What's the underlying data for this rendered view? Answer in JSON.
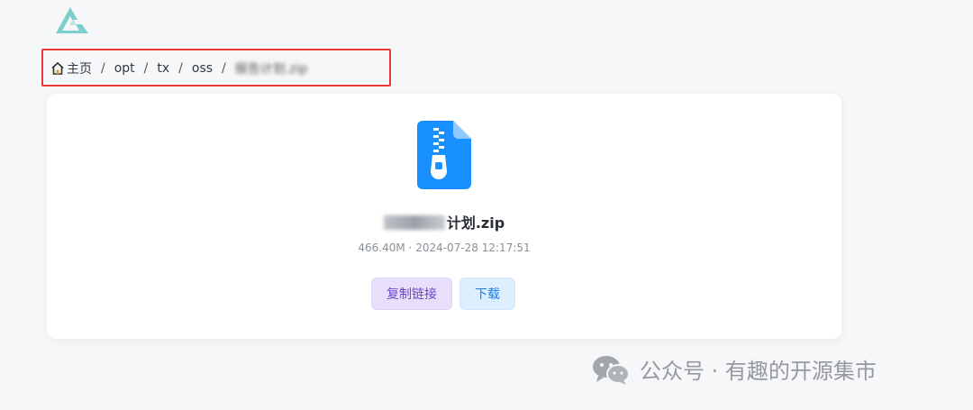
{
  "logo": {
    "icon": "app-logo-icon",
    "color": "#6cc7c4"
  },
  "breadcrumb": {
    "home_icon": "home-icon",
    "home_label": "主页",
    "separator": "/",
    "items": [
      "opt",
      "tx",
      "oss"
    ],
    "current": "报告计划.zip"
  },
  "file": {
    "icon": "zip-file-icon",
    "icon_color": "#1890ff",
    "name_visible": "计划.zip",
    "size": "466.40M",
    "meta_separator": "·",
    "modified": "2024-07-28 12:17:51"
  },
  "actions": {
    "copy_link_label": "复制链接",
    "download_label": "下载"
  },
  "watermark": {
    "icon": "wechat-icon",
    "text": "公众号 · 有趣的开源集市"
  }
}
